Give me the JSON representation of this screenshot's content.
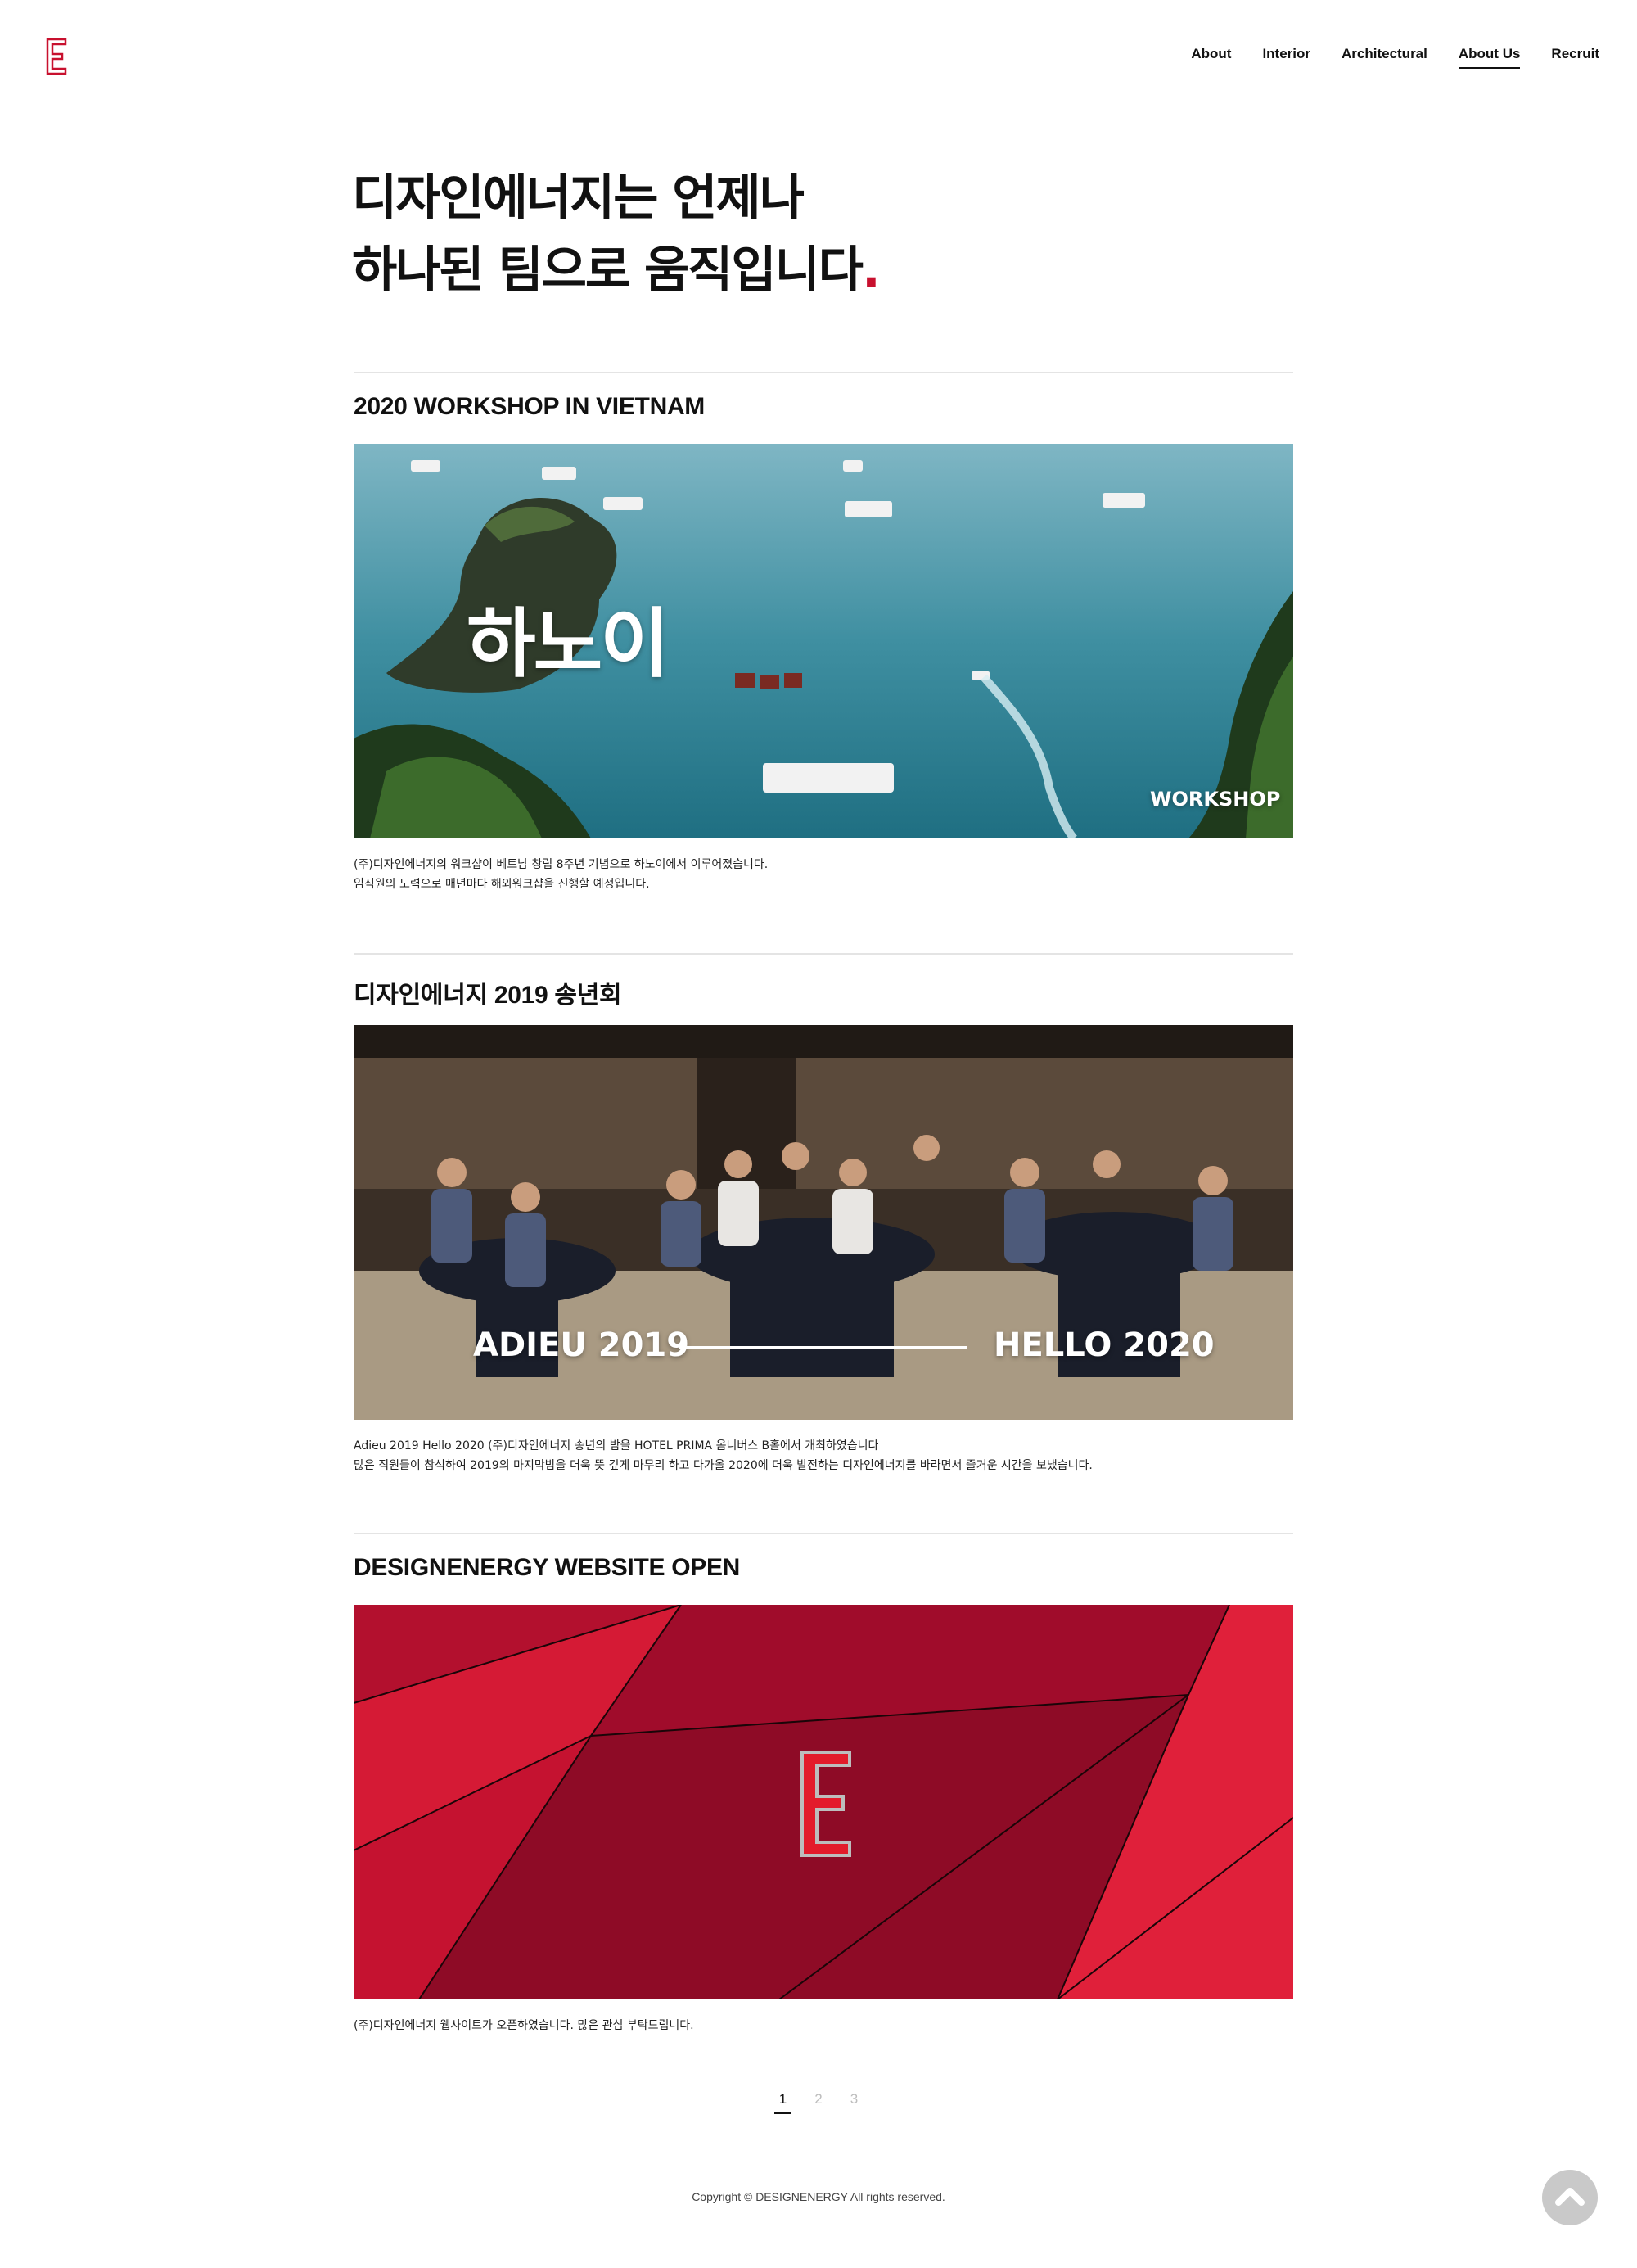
{
  "colors": {
    "accent": "#c8102e",
    "rule": "#e4e4e4",
    "text": "#111111"
  },
  "header": {
    "logo_icon": "designenergy-logo-icon",
    "nav": [
      "About",
      "Interior",
      "Architectural",
      "About Us",
      "Recruit"
    ],
    "active_nav": "About Us"
  },
  "hero": {
    "line1": "디자인에너지는 언제나",
    "line2": "하나된 팀으로 움직입니다",
    "dot": "."
  },
  "posts": [
    {
      "title": "2020 WORKSHOP IN VIETNAM",
      "image_overlay": {
        "big": "하노이",
        "small": "WORKSHOP"
      },
      "desc": [
        "(주)디자인에너지의 워크샵이 베트남 창립 8주년 기념으로 하노이에서 이루어졌습니다.",
        "임직원의 노력으로 매년마다 해외워크샵을 진행할 예정입니다."
      ]
    },
    {
      "title": "디자인에너지 2019 송년회",
      "image_overlay": {
        "left": "ADIEU 2019",
        "right": "HELLO 2020"
      },
      "desc": [
        "Adieu 2019 Hello 2020 (주)디자인에너지 송년의 밤을 HOTEL PRIMA 옴니버스 B홀에서 개최하였습니다",
        "많은 직원들이 참석하여 2019의 마지막밤을 더욱 뜻 깊게 마무리 하고 다가올 2020에 더욱 발전하는 디자인에너지를 바라면서 즐거운 시간을 보냈습니다."
      ]
    },
    {
      "title": "DESIGNENERGY WEBSITE OPEN",
      "image_overlay": {
        "logo_icon": "designenergy-logo-icon"
      },
      "desc": [
        "(주)디자인에너지 웹사이트가 오픈하였습니다. 많은 관심 부탁드립니다."
      ]
    }
  ],
  "pagination": {
    "pages": [
      "1",
      "2",
      "3"
    ],
    "current": "1"
  },
  "footer": {
    "copyright": "Copyright © DESIGNENERGY All rights reserved."
  },
  "top_button": {
    "icon": "chevron-up-icon"
  }
}
